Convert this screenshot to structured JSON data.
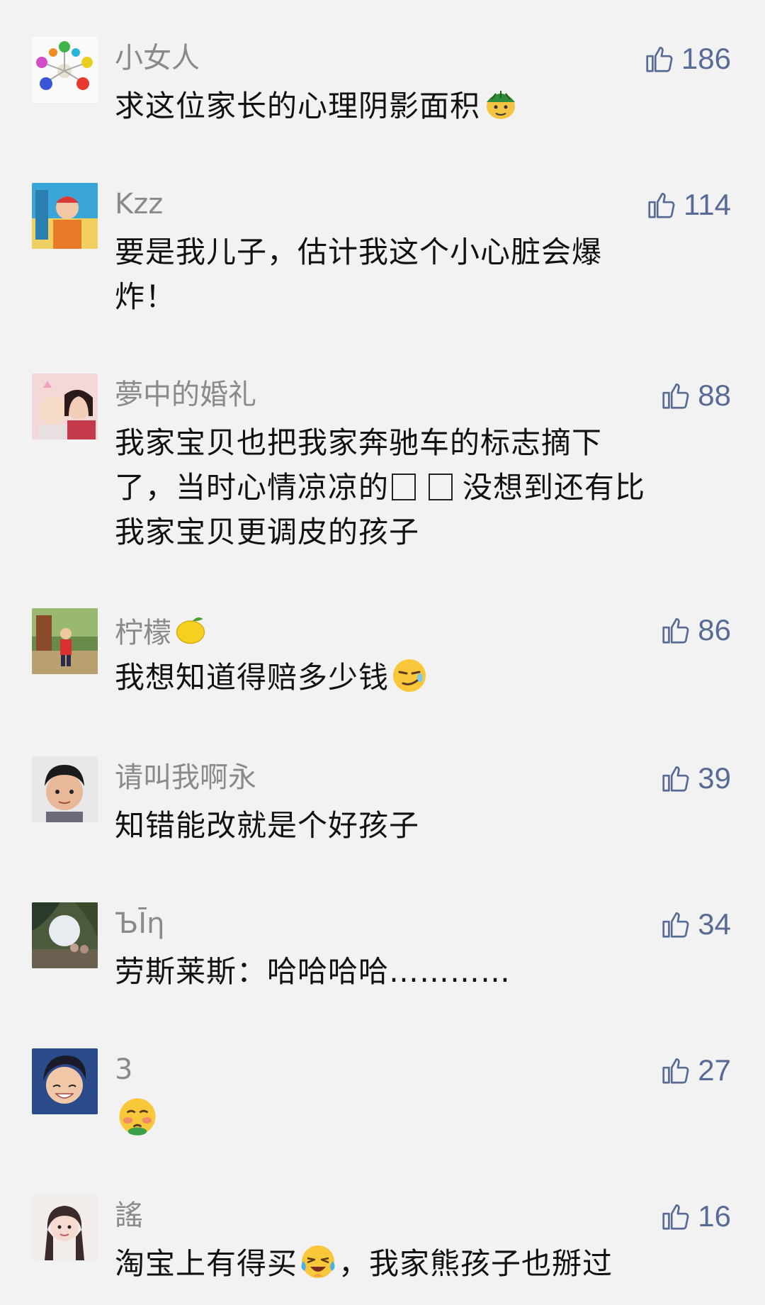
{
  "comments": [
    {
      "username": "小女人",
      "likes": "186",
      "content": "求这位家长的心理阴影面积",
      "emoji": "turtle-face-emoji"
    },
    {
      "username": "Kzz",
      "likes": "114",
      "content_line1": "要是我儿子，估计我这个小心脏会爆",
      "content_line2": "炸！"
    },
    {
      "username": "夢中的婚礼",
      "likes": "88",
      "content_line1": "我家宝贝也把我家奔驰车的标志摘下",
      "content_line2a": "了，当时心情凉凉的",
      "content_line2b": "没想到还有比",
      "content_line3": "我家宝贝更调皮的孩子"
    },
    {
      "username": "柠檬",
      "username_emoji": "lemon-emoji",
      "likes": "86",
      "content": "我想知道得赔多少钱",
      "emoji": "smirk-face-emoji"
    },
    {
      "username": "请叫我啊永",
      "likes": "39",
      "content": "知错能改就是个好孩子"
    },
    {
      "username": "ЪĪη",
      "likes": "34",
      "content": "劳斯莱斯：哈哈哈哈…………"
    },
    {
      "username": "3",
      "likes": "27",
      "emoji": "blush-face-emoji"
    },
    {
      "username": "謠",
      "likes": "16",
      "content_a": "淘宝上有得买",
      "content_b": "，我家熊孩子也掰过",
      "emoji": "crying-laugh-emoji"
    }
  ],
  "colors": {
    "background": "#f2f2f2",
    "username": "#8a8a8a",
    "like_accent": "#576b95",
    "content": "#111111"
  },
  "icons": {
    "like": "thumbs-up-icon"
  }
}
